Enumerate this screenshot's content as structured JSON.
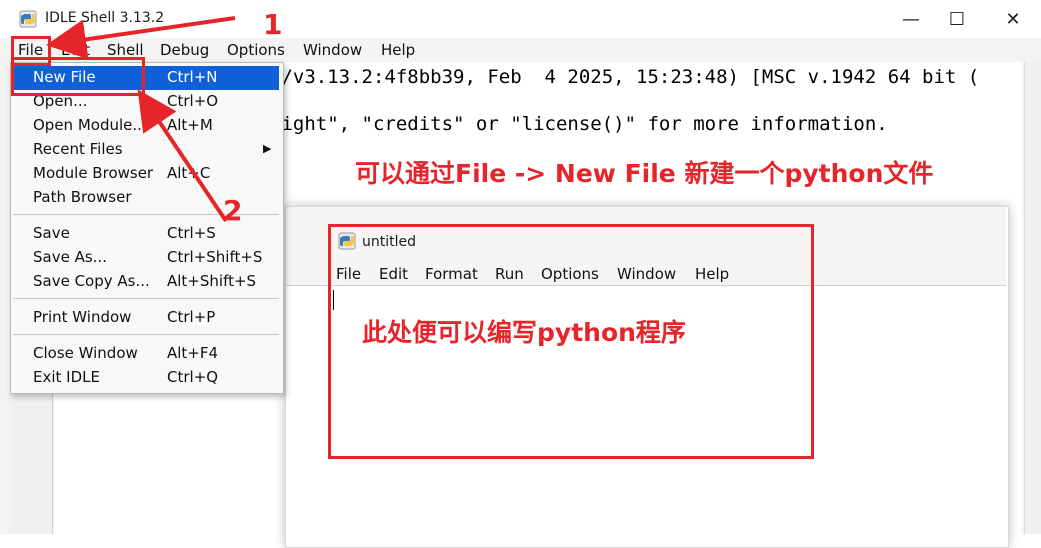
{
  "window": {
    "title": "IDLE Shell 3.13.2",
    "controls": {
      "minimize": "—",
      "maximize": "☐",
      "close": "✕"
    }
  },
  "menubar": [
    "File",
    "Edit",
    "Shell",
    "Debug",
    "Options",
    "Window",
    "Help"
  ],
  "shell": {
    "line1": "s/v3.13.2:4f8bb39, Feb  4 2025, 15:23:48) [MSC v.1942 64 bit (",
    "line2": "right\", \"credits\" or \"license()\" for more information."
  },
  "file_menu": {
    "items": [
      {
        "label": "New File",
        "shortcut": "Ctrl+N",
        "highlighted": true
      },
      {
        "label": "Open...",
        "shortcut": "Ctrl+O"
      },
      {
        "label": "Open Module...",
        "shortcut": "Alt+M"
      },
      {
        "label": "Recent Files",
        "shortcut": "",
        "submenu": true
      },
      {
        "label": "Module Browser",
        "shortcut": "Alt+C"
      },
      {
        "label": "Path Browser",
        "shortcut": ""
      },
      {
        "label": "Save",
        "shortcut": "Ctrl+S"
      },
      {
        "label": "Save As...",
        "shortcut": "Ctrl+Shift+S"
      },
      {
        "label": "Save Copy As...",
        "shortcut": "Alt+Shift+S"
      },
      {
        "label": "Print Window",
        "shortcut": "Ctrl+P"
      },
      {
        "label": "Close Window",
        "shortcut": "Alt+F4"
      },
      {
        "label": "Exit IDLE",
        "shortcut": "Ctrl+Q"
      }
    ]
  },
  "untitled_window": {
    "title": "untitled",
    "menubar": [
      "File",
      "Edit",
      "Format",
      "Run",
      "Options",
      "Window",
      "Help"
    ]
  },
  "annotations": {
    "step1": "1",
    "step2": "2",
    "caption_top": "可以通过File -> New File 新建一个python文件",
    "caption_editor": "此处便可以编写python程序",
    "color": "#e6252b"
  }
}
